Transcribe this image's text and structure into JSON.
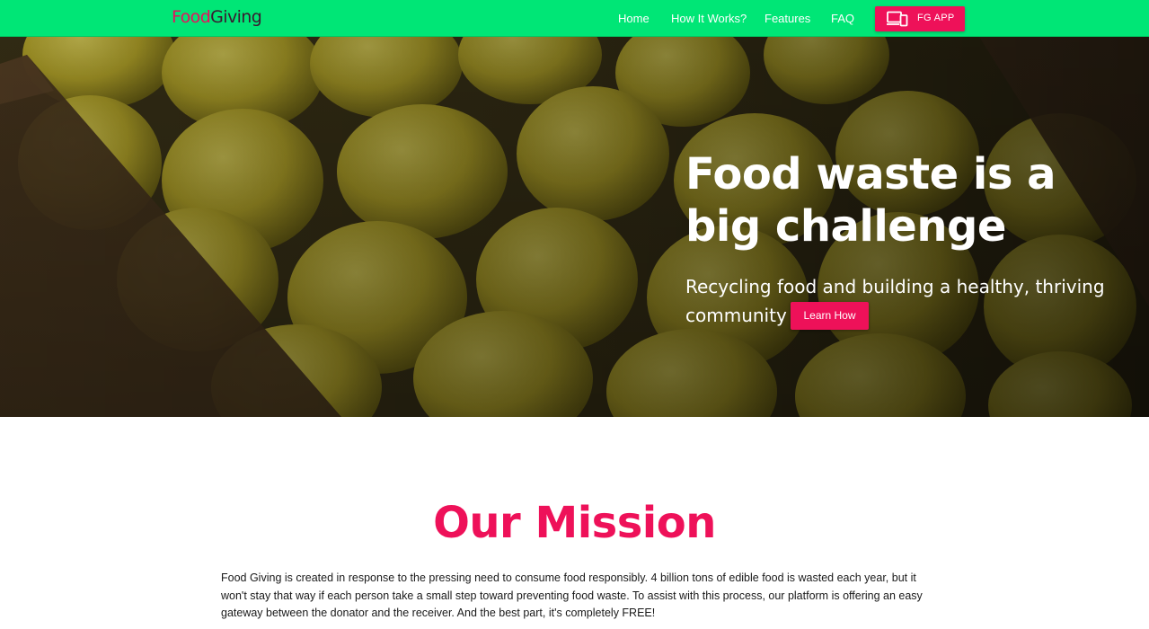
{
  "brand": {
    "logo_food": "Food",
    "logo_giving": "Giving",
    "colors": {
      "nav_green": "#00e676",
      "accent_pink": "#ee1159"
    }
  },
  "nav": {
    "links": [
      {
        "label": "Home"
      },
      {
        "label": "How It Works?"
      },
      {
        "label": "Features"
      },
      {
        "label": "FAQ"
      }
    ],
    "app_button": {
      "label": "FG APP",
      "icon": "devices-icon"
    }
  },
  "hero": {
    "title": "Food waste is a big challenge",
    "subtitle": "Recycling food and building a healthy, thriving community",
    "cta": "Learn How",
    "background": "lemons-in-crate-photo"
  },
  "mission": {
    "title": "Our Mission",
    "body": "Food Giving is created in response to the pressing need to consume food responsibly. 4 billion tons of edible food is wasted each year, but it won't stay that way if each person take a small step toward preventing food waste. To assist with this process, our platform is offering an easy gateway between the donator and the receiver. And the best part, it's completely FREE!"
  }
}
